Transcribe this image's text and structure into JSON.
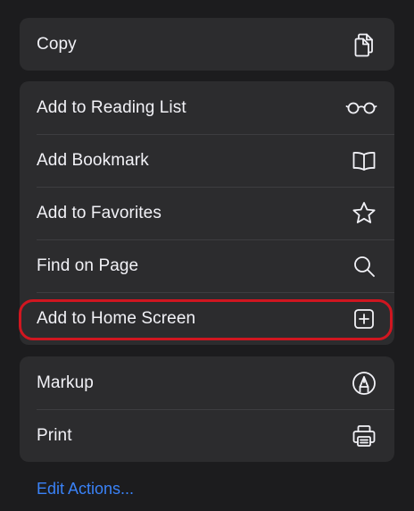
{
  "groups": {
    "copy": {
      "label": "Copy",
      "icon": "copy-icon"
    },
    "main": {
      "items": [
        {
          "label": "Add to Reading List",
          "icon": "glasses-icon"
        },
        {
          "label": "Add Bookmark",
          "icon": "book-icon"
        },
        {
          "label": "Add to Favorites",
          "icon": "star-icon"
        },
        {
          "label": "Find on Page",
          "icon": "search-icon"
        },
        {
          "label": "Add to Home Screen",
          "icon": "plus-square-icon"
        }
      ]
    },
    "tools": {
      "items": [
        {
          "label": "Markup",
          "icon": "markup-pen-icon"
        },
        {
          "label": "Print",
          "icon": "printer-icon"
        }
      ]
    }
  },
  "footer": {
    "edit_actions_label": "Edit Actions..."
  },
  "colors": {
    "background": "#1c1c1e",
    "group_background": "#2c2c2e",
    "text": "#f2f2f7",
    "link": "#3a82f7",
    "highlight_ring": "#d01620"
  }
}
